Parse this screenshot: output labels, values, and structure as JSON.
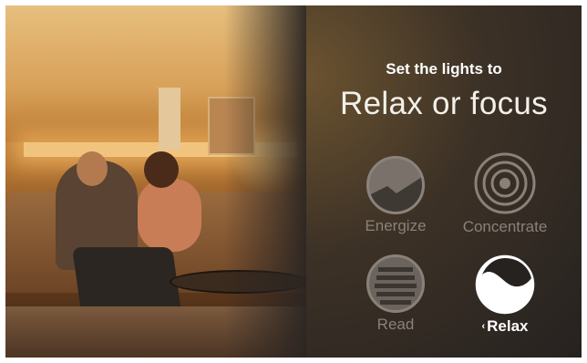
{
  "panel": {
    "kicker": "Set the lights to",
    "headline": "Relax or focus"
  },
  "modes": [
    {
      "label": "Energize",
      "icon": "energize-icon",
      "selected": false
    },
    {
      "label": "Concentrate",
      "icon": "concentric-rings-icon",
      "selected": false
    },
    {
      "label": "Read",
      "icon": "horizontal-lines-icon",
      "selected": false
    },
    {
      "label": "Relax",
      "icon": "yin-yang-icon",
      "selected": true,
      "prefix": "‹"
    }
  ],
  "colors": {
    "panel_dark": "#262220",
    "panel_glow": "#6b5330",
    "inactive_icon": "#7a716a",
    "inactive_text": "#8a8178",
    "active": "#ffffff"
  }
}
